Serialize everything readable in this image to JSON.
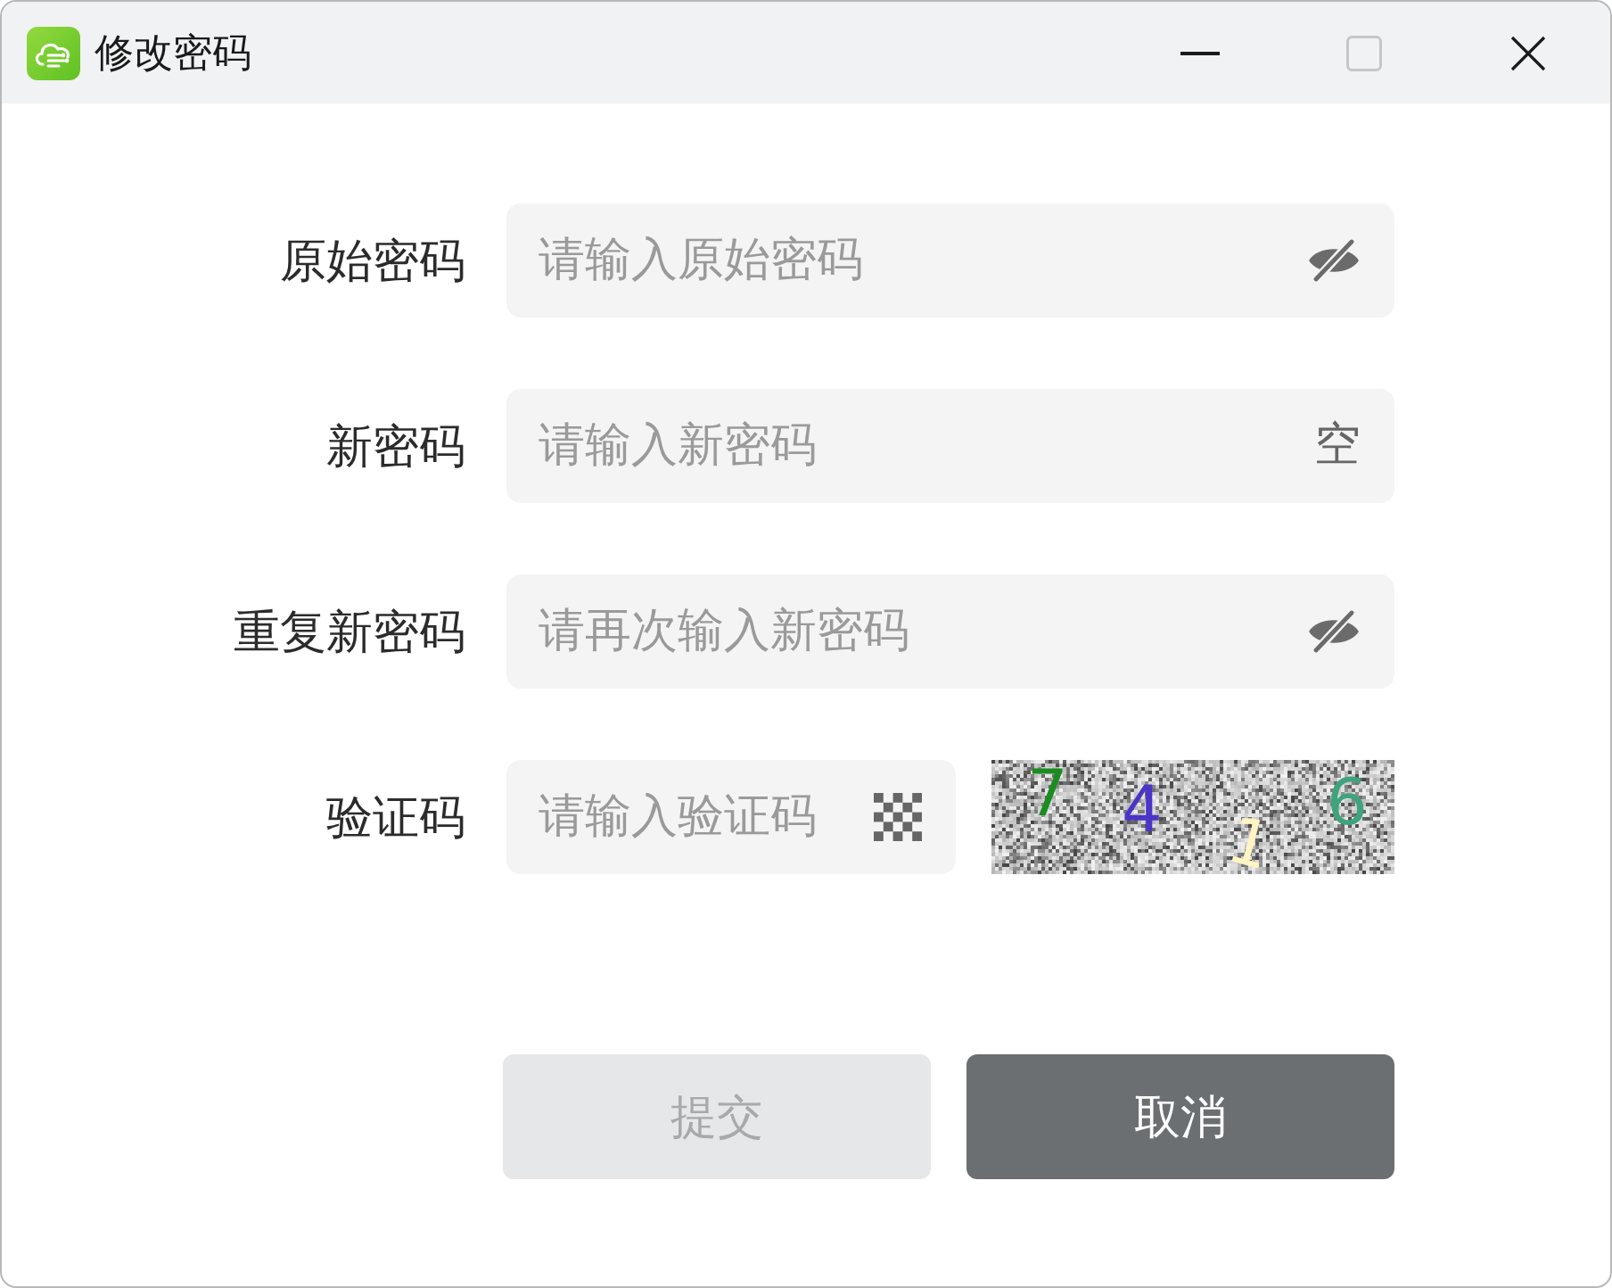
{
  "window": {
    "title": "修改密码",
    "controls": [
      {
        "kind": "minimize",
        "disabled": false
      },
      {
        "kind": "maximize",
        "disabled": true
      },
      {
        "kind": "close",
        "disabled": false
      }
    ]
  },
  "form": {
    "fields": [
      {
        "label": "原始密码",
        "placeholder": "请输入原始密码",
        "suffix": {
          "kind": "eye-off"
        }
      },
      {
        "label": "新密码",
        "placeholder": "请输入新密码",
        "suffix": {
          "kind": "text",
          "text": "空"
        }
      },
      {
        "label": "重复新密码",
        "placeholder": "请再次输入新密码",
        "suffix": {
          "kind": "eye-off"
        }
      },
      {
        "label": "验证码",
        "placeholder": "请输入验证码",
        "suffix": {
          "kind": "mosaic"
        },
        "captcha": {
          "digits": [
            {
              "text": "7",
              "color": "#1b8c22"
            },
            {
              "text": "4",
              "color": "#4a35c8"
            },
            {
              "text": "1",
              "color": "#fff4c2"
            },
            {
              "text": "6",
              "color": "#3fa37d"
            }
          ]
        }
      }
    ]
  },
  "buttons": [
    {
      "label": "提交",
      "disabled": true
    },
    {
      "label": "取消",
      "disabled": false
    }
  ]
}
